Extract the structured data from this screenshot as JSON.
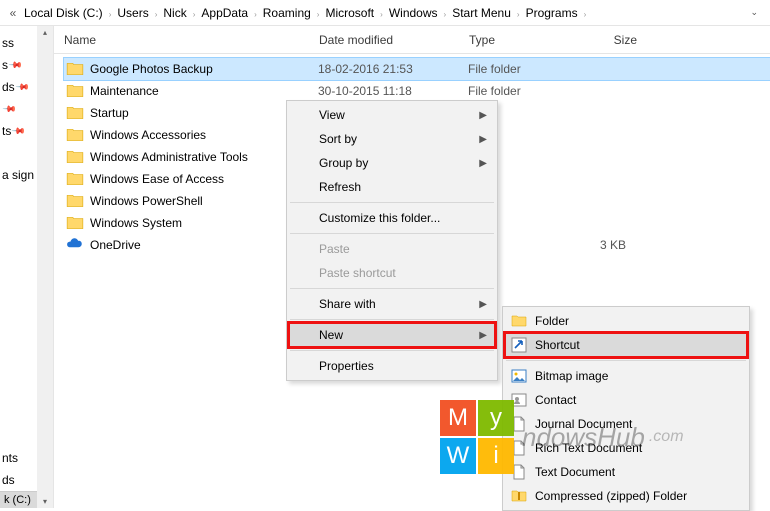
{
  "breadcrumb": {
    "prefix": "«",
    "items": [
      "Local Disk (C:)",
      "Users",
      "Nick",
      "AppData",
      "Roaming",
      "Microsoft",
      "Windows",
      "Start Menu",
      "Programs"
    ]
  },
  "columns": {
    "name": "Name",
    "date": "Date modified",
    "type": "Type",
    "size": "Size"
  },
  "sidebar": {
    "items": [
      {
        "label": "ss",
        "pinned": false
      },
      {
        "label": "s",
        "pinned": true
      },
      {
        "label": "ds",
        "pinned": true
      },
      {
        "label": "",
        "pinned": true
      },
      {
        "label": "ts",
        "pinned": true
      },
      {
        "label": "",
        "pinned": false
      },
      {
        "label": "a sign a",
        "pinned": false
      }
    ],
    "bottom_items": [
      {
        "label": "nts"
      },
      {
        "label": "ds"
      }
    ],
    "disk": "k (C:)"
  },
  "files": [
    {
      "name": "Google Photos Backup",
      "date": "18-02-2016 21:53",
      "type": "File folder",
      "size": "",
      "icon": "folder",
      "selected": true
    },
    {
      "name": "Maintenance",
      "date": "30-10-2015 11:18",
      "type": "File folder",
      "size": "",
      "icon": "folder"
    },
    {
      "name": "Startup",
      "date": "",
      "type": "",
      "size": "",
      "icon": "folder"
    },
    {
      "name": "Windows Accessories",
      "date": "",
      "type": "",
      "size": "",
      "icon": "folder"
    },
    {
      "name": "Windows Administrative Tools",
      "date": "",
      "type": "",
      "size": "",
      "icon": "folder"
    },
    {
      "name": "Windows Ease of Access",
      "date": "",
      "type": "",
      "size": "",
      "icon": "folder"
    },
    {
      "name": "Windows PowerShell",
      "date": "",
      "type": "",
      "size": "",
      "icon": "folder"
    },
    {
      "name": "Windows System",
      "date": "",
      "type": "",
      "size": "",
      "icon": "folder"
    },
    {
      "name": "OneDrive",
      "date": "",
      "type": "",
      "size": "3 KB",
      "icon": "onedrive"
    }
  ],
  "context_menu": {
    "items": [
      {
        "label": "View",
        "submenu": true
      },
      {
        "label": "Sort by",
        "submenu": true
      },
      {
        "label": "Group by",
        "submenu": true
      },
      {
        "label": "Refresh"
      },
      {
        "sep": true
      },
      {
        "label": "Customize this folder..."
      },
      {
        "sep": true
      },
      {
        "label": "Paste",
        "disabled": true
      },
      {
        "label": "Paste shortcut",
        "disabled": true
      },
      {
        "sep": true
      },
      {
        "label": "Share with",
        "submenu": true
      },
      {
        "sep": true
      },
      {
        "label": "New",
        "submenu": true,
        "hovered": true,
        "highlight": true
      },
      {
        "sep": true
      },
      {
        "label": "Properties"
      }
    ]
  },
  "new_submenu": {
    "items": [
      {
        "label": "Folder",
        "icon": "folder"
      },
      {
        "label": "Shortcut",
        "icon": "shortcut",
        "hovered": true,
        "highlight": true
      },
      {
        "sep": true
      },
      {
        "label": "Bitmap image",
        "icon": "bitmap"
      },
      {
        "label": "Contact",
        "icon": "contact"
      },
      {
        "label": "Journal Document",
        "icon": "journal"
      },
      {
        "label": "Rich Text Document",
        "icon": "rtf"
      },
      {
        "label": "Text Document",
        "icon": "txt"
      },
      {
        "label": "Compressed (zipped) Folder",
        "icon": "zip"
      }
    ]
  },
  "watermark": {
    "tiles": [
      "M",
      "y",
      "W",
      "i"
    ],
    "text": "ndowsHub",
    "sub": ".com"
  }
}
